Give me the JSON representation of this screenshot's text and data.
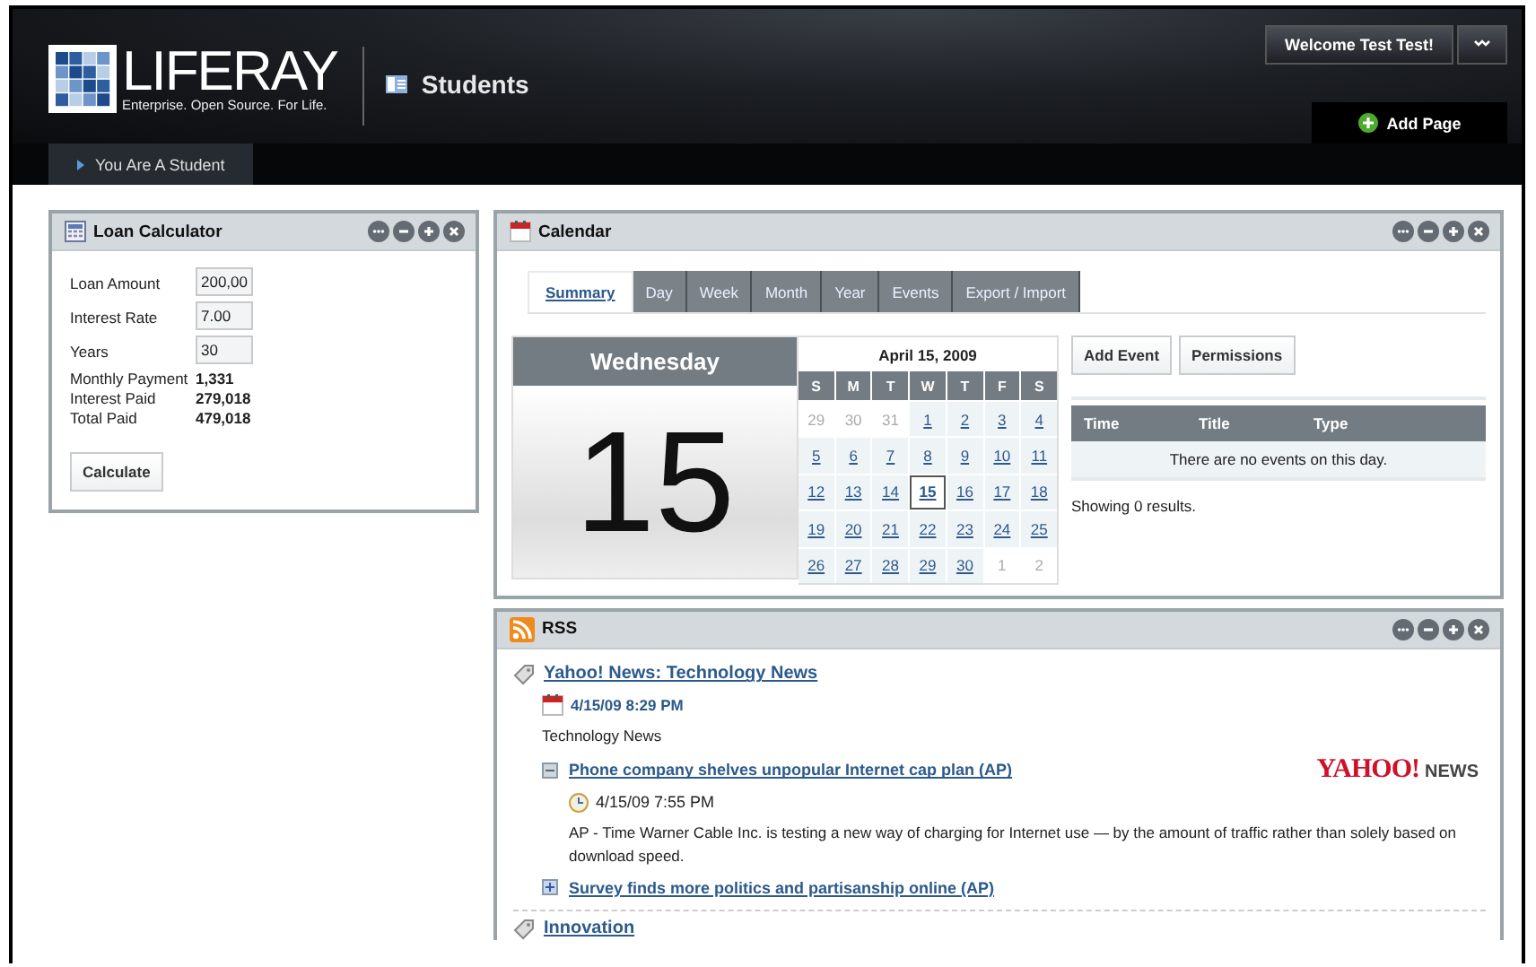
{
  "header": {
    "logo_text": "LIFERAY",
    "tagline": "Enterprise. Open Source. For Life.",
    "page_title": "Students",
    "welcome": "Welcome Test Test!",
    "add_page": "Add Page",
    "nav": [
      {
        "label": "You Are A Student",
        "selected": true
      }
    ]
  },
  "loan_calculator": {
    "title": "Loan Calculator",
    "fields": [
      {
        "label": "Loan Amount",
        "value": "200,00"
      },
      {
        "label": "Interest Rate",
        "value": "7.00"
      },
      {
        "label": "Years",
        "value": "30"
      }
    ],
    "results": [
      {
        "label": "Monthly Payment",
        "value": "1,331"
      },
      {
        "label": "Interest Paid",
        "value": "279,018"
      },
      {
        "label": "Total Paid",
        "value": "479,018"
      }
    ],
    "button": "Calculate"
  },
  "calendar": {
    "title": "Calendar",
    "tabs": [
      {
        "label": "Summary",
        "selected": true
      },
      {
        "label": "Day",
        "selected": false
      },
      {
        "label": "Week",
        "selected": false
      },
      {
        "label": "Month",
        "selected": false
      },
      {
        "label": "Year",
        "selected": false
      },
      {
        "label": "Events",
        "selected": false
      },
      {
        "label": "Export / Import",
        "selected": false
      }
    ],
    "day_name": "Wednesday",
    "day_number": "15",
    "month_title": "April 15, 2009",
    "weekdays": [
      "S",
      "M",
      "T",
      "W",
      "T",
      "F",
      "S"
    ],
    "weeks": [
      [
        {
          "label": "29",
          "in_month": false,
          "selected": false
        },
        {
          "label": "30",
          "in_month": false,
          "selected": false
        },
        {
          "label": "31",
          "in_month": false,
          "selected": false
        },
        {
          "label": "1",
          "in_month": true,
          "selected": false
        },
        {
          "label": "2",
          "in_month": true,
          "selected": false
        },
        {
          "label": "3",
          "in_month": true,
          "selected": false
        },
        {
          "label": "4",
          "in_month": true,
          "selected": false
        }
      ],
      [
        {
          "label": "5",
          "in_month": true,
          "selected": false
        },
        {
          "label": "6",
          "in_month": true,
          "selected": false
        },
        {
          "label": "7",
          "in_month": true,
          "selected": false
        },
        {
          "label": "8",
          "in_month": true,
          "selected": false
        },
        {
          "label": "9",
          "in_month": true,
          "selected": false
        },
        {
          "label": "10",
          "in_month": true,
          "selected": false
        },
        {
          "label": "11",
          "in_month": true,
          "selected": false
        }
      ],
      [
        {
          "label": "12",
          "in_month": true,
          "selected": false
        },
        {
          "label": "13",
          "in_month": true,
          "selected": false
        },
        {
          "label": "14",
          "in_month": true,
          "selected": false
        },
        {
          "label": "15",
          "in_month": true,
          "selected": true
        },
        {
          "label": "16",
          "in_month": true,
          "selected": false
        },
        {
          "label": "17",
          "in_month": true,
          "selected": false
        },
        {
          "label": "18",
          "in_month": true,
          "selected": false
        }
      ],
      [
        {
          "label": "19",
          "in_month": true,
          "selected": false
        },
        {
          "label": "20",
          "in_month": true,
          "selected": false
        },
        {
          "label": "21",
          "in_month": true,
          "selected": false
        },
        {
          "label": "22",
          "in_month": true,
          "selected": false
        },
        {
          "label": "23",
          "in_month": true,
          "selected": false
        },
        {
          "label": "24",
          "in_month": true,
          "selected": false
        },
        {
          "label": "25",
          "in_month": true,
          "selected": false
        }
      ],
      [
        {
          "label": "26",
          "in_month": true,
          "selected": false
        },
        {
          "label": "27",
          "in_month": true,
          "selected": false
        },
        {
          "label": "28",
          "in_month": true,
          "selected": false
        },
        {
          "label": "29",
          "in_month": true,
          "selected": false
        },
        {
          "label": "30",
          "in_month": true,
          "selected": false
        },
        {
          "label": "1",
          "in_month": false,
          "selected": false
        },
        {
          "label": "2",
          "in_month": false,
          "selected": false
        }
      ]
    ],
    "buttons": [
      "Add Event",
      "Permissions"
    ],
    "table": {
      "columns": [
        "Time",
        "Title",
        "Type"
      ],
      "empty_message": "There are no events on this day."
    },
    "results": "Showing 0 results."
  },
  "rss": {
    "title": "RSS",
    "feeds": [
      {
        "title": "Yahoo! News: Technology News",
        "date": "4/15/09 8:29 PM",
        "description": "Technology News",
        "logo": {
          "brand": "YAHOO!",
          "label": "NEWS"
        },
        "items": [
          {
            "title": "Phone company shelves unpopular Internet cap plan (AP)",
            "expanded": true,
            "date": "4/15/09 7:55 PM",
            "summary": "AP - Time Warner Cable Inc. is testing a new way of charging for Internet use — by the amount of traffic rather than solely based on download speed."
          },
          {
            "title": "Survey finds more politics and partisanship online (AP)",
            "expanded": false
          }
        ]
      },
      {
        "title": "Innovation"
      }
    ]
  }
}
